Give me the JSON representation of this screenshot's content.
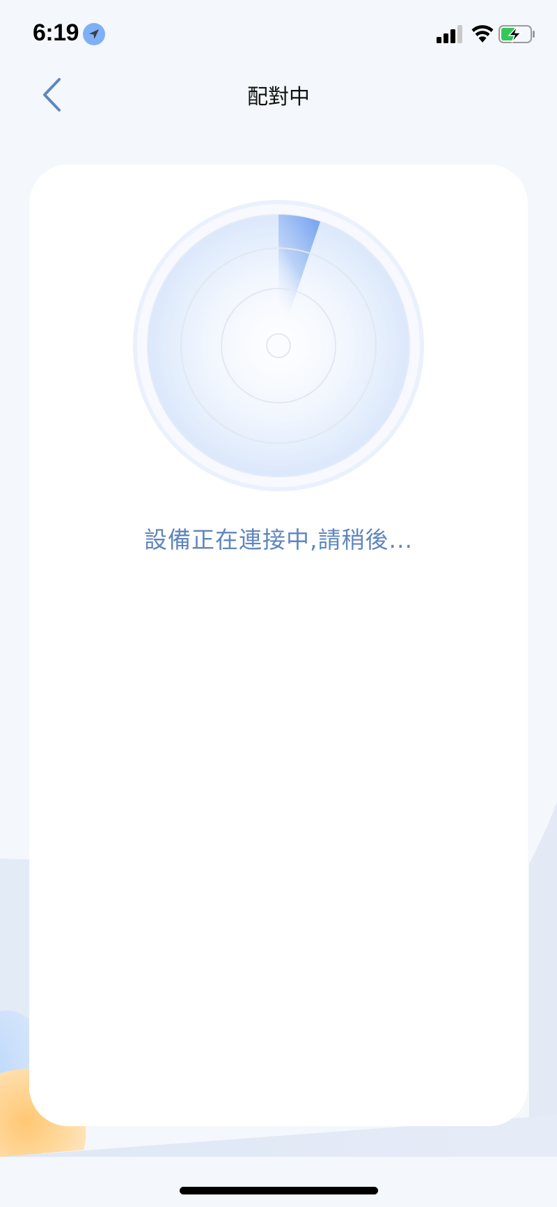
{
  "status_bar": {
    "time": "6:19",
    "location_icon": "location-arrow-icon",
    "signal_icon": "cellular-signal-icon",
    "wifi_icon": "wifi-icon",
    "battery_icon": "battery-charging-icon",
    "battery_color": "#34c759"
  },
  "header": {
    "back_icon": "chevron-left-icon",
    "title": "配對中"
  },
  "main": {
    "radar_icon": "radar-scan-icon",
    "message": "設備正在連接中,請稍後..."
  },
  "colors": {
    "accent": "#5f86bd",
    "radar_sweep": "#7ea8f0",
    "background": "#f4f7fb"
  }
}
